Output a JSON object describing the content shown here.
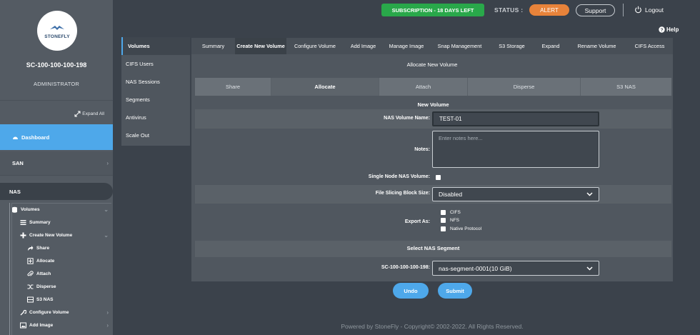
{
  "sidebar": {
    "logo_text": "STONEFLY",
    "host_name": "SC-100-100-100-198",
    "role": "ADMINISTRATOR",
    "expand_all": "Expand All",
    "dashboard": "Dashboard",
    "san": "SAN",
    "nas": "NAS",
    "tree": {
      "volumes": "Volumes",
      "summary": "Summary",
      "create_new_volume": "Create New Volume",
      "share": "Share",
      "allocate": "Allocate",
      "attach": "Attach",
      "disperse": "Disperse",
      "s3_nas": "S3 NAS",
      "configure_volume": "Configure Volume",
      "add_image": "Add Image"
    }
  },
  "topbar": {
    "subscription": "SUBSCRIPTION - 18 DAYS LEFT",
    "status_label": "STATUS :",
    "alert": "ALERT",
    "support": "Support",
    "logout": "Logout",
    "help": "Help"
  },
  "vtabs": [
    "Volumes",
    "CIFS Users",
    "NAS Sessions",
    "Segments",
    "Antivirus",
    "Scale Out"
  ],
  "htabs": [
    "Summary",
    "Create New Volume",
    "Configure Volume",
    "Add Image",
    "Manage Image",
    "Snap Management",
    "S3 Storage",
    "Expand",
    "Rename Volume",
    "CIFS Access"
  ],
  "panel": {
    "title": "Allocate New Volume",
    "mode_tabs": [
      "Share",
      "Allocate",
      "Attach",
      "Disperse",
      "S3 NAS"
    ],
    "new_volume_head": "New Volume",
    "volume_name_label": "NAS Volume Name:",
    "volume_name_value": "TEST-01",
    "notes_label": "Notes:",
    "notes_placeholder": "Enter notes here...",
    "single_node_label": "Single Node NAS Volume:",
    "block_size_label": "File Slicing Block Size:",
    "block_size_value": "Disabled",
    "export_label": "Export As:",
    "export_options": [
      "CIFS",
      "NFS",
      "Native Protocol"
    ],
    "segment_head": "Select NAS Segment",
    "segment_label": "SC-100-100-100-198:",
    "segment_value": "nas-segment-0001(10 GiB)"
  },
  "buttons": {
    "undo": "Undo",
    "submit": "Submit"
  },
  "footer": "Powered by StoneFly - Copyright© 2002-2022. All Rights Reserved.",
  "colors": {
    "accent": "#4ea8ea",
    "subscription": "#29a84a",
    "alert": "#e8833a"
  }
}
